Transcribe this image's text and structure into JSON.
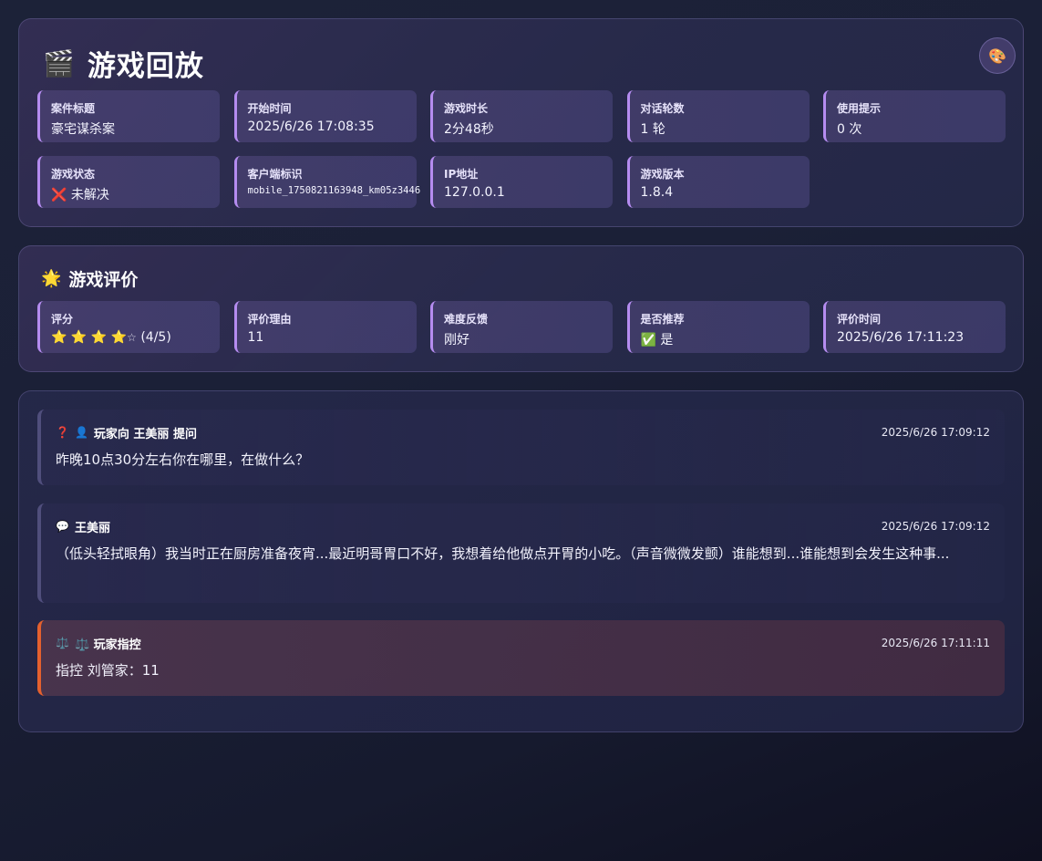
{
  "header": {
    "title": "游戏回放",
    "title_icon": "🎬",
    "theme_icon": "🎨",
    "meta": [
      {
        "label": "案件标题",
        "value": "豪宅谋杀案"
      },
      {
        "label": "开始时间",
        "value": "2025/6/26 17:08:35"
      },
      {
        "label": "游戏时长",
        "value": "2分48秒"
      },
      {
        "label": "对话轮数",
        "value": "1 轮"
      },
      {
        "label": "使用提示",
        "value": "0 次"
      },
      {
        "label": "游戏状态",
        "value": "❌ 未解决"
      },
      {
        "label": "客户端标识",
        "value": "mobile_1750821163948_km05z3446"
      },
      {
        "label": "IP地址",
        "value": "127.0.0.1"
      },
      {
        "label": "游戏版本",
        "value": "1.8.4"
      }
    ]
  },
  "rating": {
    "title": "游戏评价",
    "title_icon": "🌟",
    "score_label": "评分",
    "score_stars": 4,
    "score_max": 5,
    "score_text": "(4/5)",
    "items": [
      {
        "label": "评价理由",
        "value": "11"
      },
      {
        "label": "难度反馈",
        "value": "刚好"
      },
      {
        "label": "是否推荐",
        "value": "✅ 是"
      },
      {
        "label": "评价时间",
        "value": "2025/6/26 17:11:23"
      }
    ]
  },
  "dialog": {
    "question": {
      "icon": "❓",
      "avatar_icon": "👤",
      "who": "玩家向 王美丽 提问",
      "time": "2025/6/26 17:09:12",
      "text": "昨晚10点30分左右你在哪里，在做什么？"
    },
    "answer": {
      "icon": "💬",
      "who": "王美丽",
      "time": "2025/6/26 17:09:12",
      "text": "（低头轻拭眼角）我当时正在厨房准备夜宵...最近明哥胃口不好，我想着给他做点开胃的小吃。（声音微微发颤）谁能想到...谁能想到会发生这种事..."
    },
    "accuse": {
      "icon": "⚖️",
      "who": "⚖️ 玩家指控",
      "time": "2025/6/26 17:11:11",
      "text": "指控 刘管家：11"
    }
  }
}
